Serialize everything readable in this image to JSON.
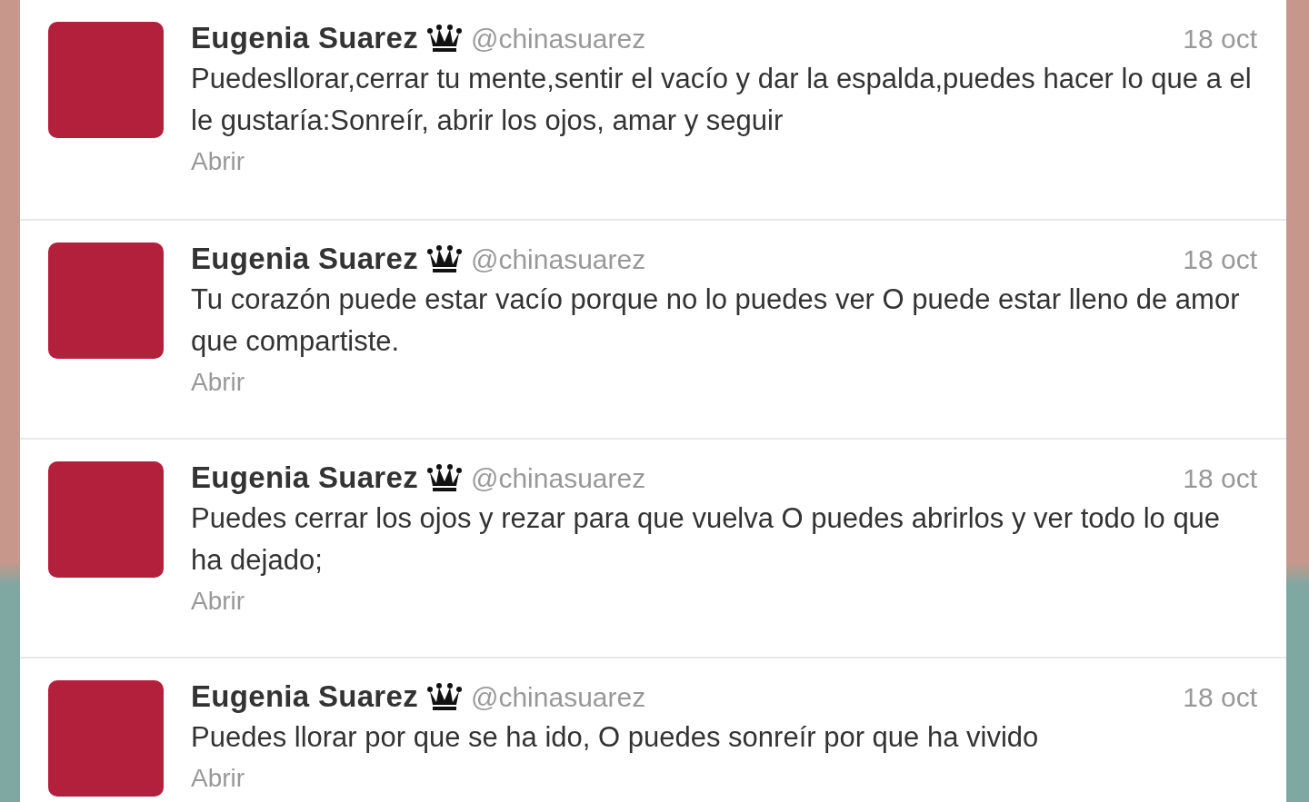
{
  "tweets": [
    {
      "name": "Eugenia Suarez",
      "handle": "@chinasuarez",
      "date": "18 oct",
      "text": "Puedesllorar,cerrar tu mente,sentir el vacío y dar la espalda,puedes hacer lo que a el le gustaría:Sonreír, abrir los ojos, amar y seguir",
      "action": "Abrir"
    },
    {
      "name": "Eugenia Suarez",
      "handle": "@chinasuarez",
      "date": "18 oct",
      "text": "Tu corazón puede estar vacío porque no lo puedes ver O puede estar lleno de amor que compartiste.",
      "action": "Abrir"
    },
    {
      "name": "Eugenia Suarez",
      "handle": "@chinasuarez",
      "date": "18 oct",
      "text": "Puedes cerrar los ojos y rezar para que vuelva O puedes abrirlos y ver todo lo que ha dejado;",
      "action": "Abrir"
    },
    {
      "name": "Eugenia Suarez",
      "handle": "@chinasuarez",
      "date": "18 oct",
      "text": "Puedes llorar por que se ha ido, O puedes sonreír por que ha vivido",
      "action": "Abrir"
    }
  ]
}
